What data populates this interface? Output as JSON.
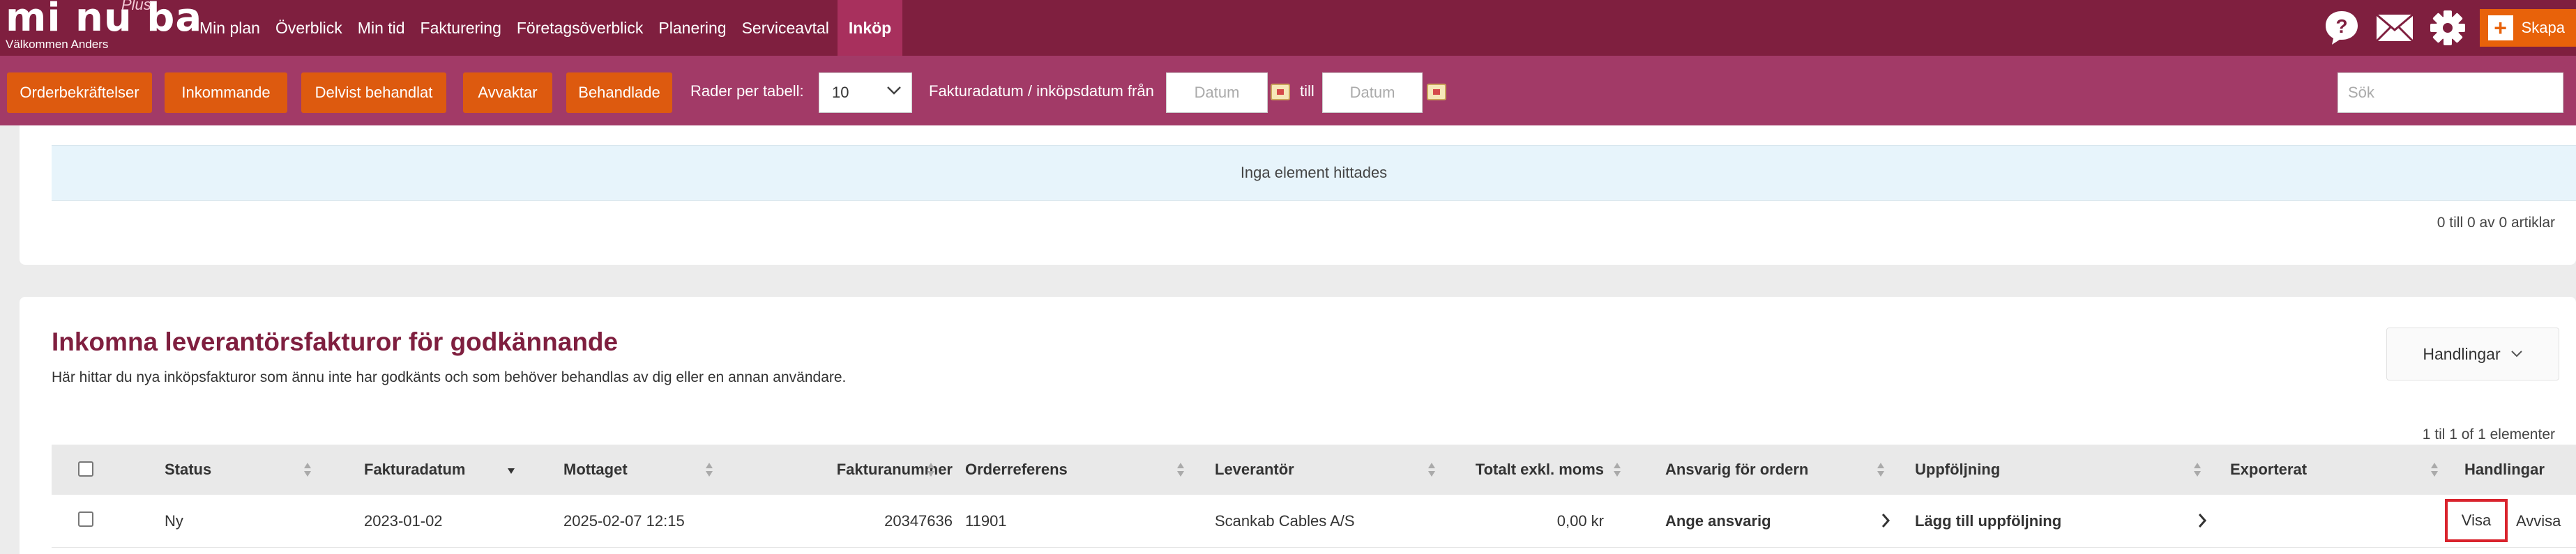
{
  "brand": {
    "logo_text": "mi nu ba",
    "plus_label": "Plus",
    "welcome": "Välkommen Anders"
  },
  "nav": {
    "items": [
      {
        "label": "Min plan"
      },
      {
        "label": "Överblick"
      },
      {
        "label": "Min tid"
      },
      {
        "label": "Fakturering"
      },
      {
        "label": "Företagsöverblick"
      },
      {
        "label": "Planering"
      },
      {
        "label": "Serviceavtal"
      },
      {
        "label": "Inköp",
        "active": true
      }
    ],
    "icons": [
      "help-icon",
      "mail-icon",
      "gear-icon"
    ],
    "create_label": "Skapa"
  },
  "filters": {
    "buttons": [
      "Orderbekräftelser",
      "Inkommande",
      "Delvist behandlat",
      "Avvaktar",
      "Behandlade"
    ],
    "rows_label": "Rader per tabell:",
    "rows_value": "10",
    "date_label": "Fakturadatum / inköpsdatum från",
    "date_from_placeholder": "Datum",
    "to_label": "till",
    "date_to_placeholder": "Datum",
    "search_placeholder": "Sök"
  },
  "section_top": {
    "empty_text": "Inga element hittades",
    "count_text": "0 till 0 av 0 artiklar"
  },
  "section_invoices": {
    "title": "Inkomna leverantörsfakturor för godkännande",
    "description": "Här hittar du nya inköpsfakturor som ännu inte har godkänts och som behöver behandlas av dig eller en annan användare.",
    "actions_label": "Handlingar",
    "count_text": "1 til 1 of 1 elementer",
    "columns": {
      "status": "Status",
      "invoice_date": "Fakturadatum",
      "received": "Mottaget",
      "invoice_number": "Fakturanummer",
      "order_ref": "Orderreferens",
      "supplier": "Leverantör",
      "total": "Totalt exkl. moms",
      "responsible": "Ansvarig för ordern",
      "followup": "Uppföljning",
      "exported": "Exporterat",
      "actions": "Handlingar"
    },
    "rows": [
      {
        "status": "Ny",
        "invoice_date": "2023-01-02",
        "received": "2025-02-07 12:15",
        "invoice_number": "20347636",
        "order_ref": "11901",
        "supplier": "Scankab Cables A/S",
        "total": "0,00 kr",
        "responsible": "Ange ansvarig",
        "followup": "Lägg till uppföljning",
        "exported": "",
        "view_label": "Visa",
        "reject_label": "Avvisa"
      }
    ]
  },
  "colors": {
    "nav_bg": "#7f1f3f",
    "nav_active": "#a8305d",
    "filter_bg": "#a23a67",
    "button_orange": "#dd5a0f",
    "title_color": "#7f1f3f",
    "highlight_border": "#d9232d"
  }
}
